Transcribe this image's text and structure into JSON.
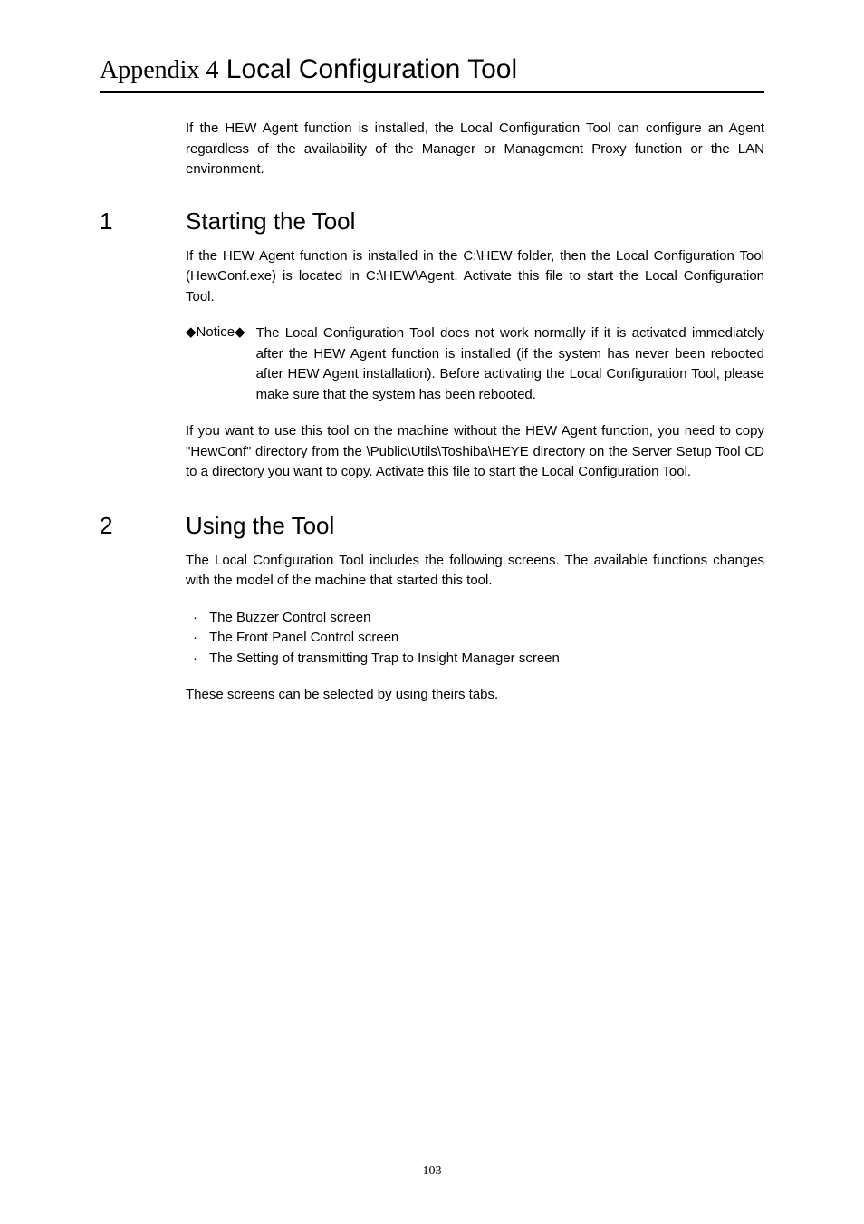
{
  "appendix": {
    "prefix": "Appendix 4",
    "title": "Local Configuration Tool",
    "intro": "If the HEW Agent function is installed, the Local Configuration Tool can configure an Agent regardless of the availability of the Manager or Management Proxy function or the LAN environment."
  },
  "section1": {
    "number": "1",
    "title": "Starting the Tool",
    "para1": "If the HEW Agent function is installed in the C:\\HEW folder, then the Local Configuration Tool (HewConf.exe) is located in C:\\HEW\\Agent. Activate this file to start the Local Configuration Tool.",
    "notice_label": "◆Notice◆",
    "notice_text": "The Local Configuration Tool does not work normally if it is activated immediately after the HEW Agent function is installed (if the system has never been rebooted after HEW Agent installation). Before activating the Local Configuration Tool, please make sure that the system has been rebooted.",
    "para2": "If you want to use this tool on the machine without the HEW Agent function, you need to copy \"HewConf\" directory from the \\Public\\Utils\\Toshiba\\HEYE directory on the Server Setup Tool CD to a directory you want to copy. Activate this file to start the Local Configuration Tool."
  },
  "section2": {
    "number": "2",
    "title": "Using the Tool",
    "para1": "The Local Configuration Tool includes the following screens. The available functions changes with the model of the machine that started this tool.",
    "bullets": {
      "0": "The Buzzer Control screen",
      "1": "The Front Panel Control screen",
      "2": "The Setting of transmitting Trap to Insight Manager screen"
    },
    "para2": "These screens can be selected by using theirs tabs."
  },
  "page_number": "103"
}
